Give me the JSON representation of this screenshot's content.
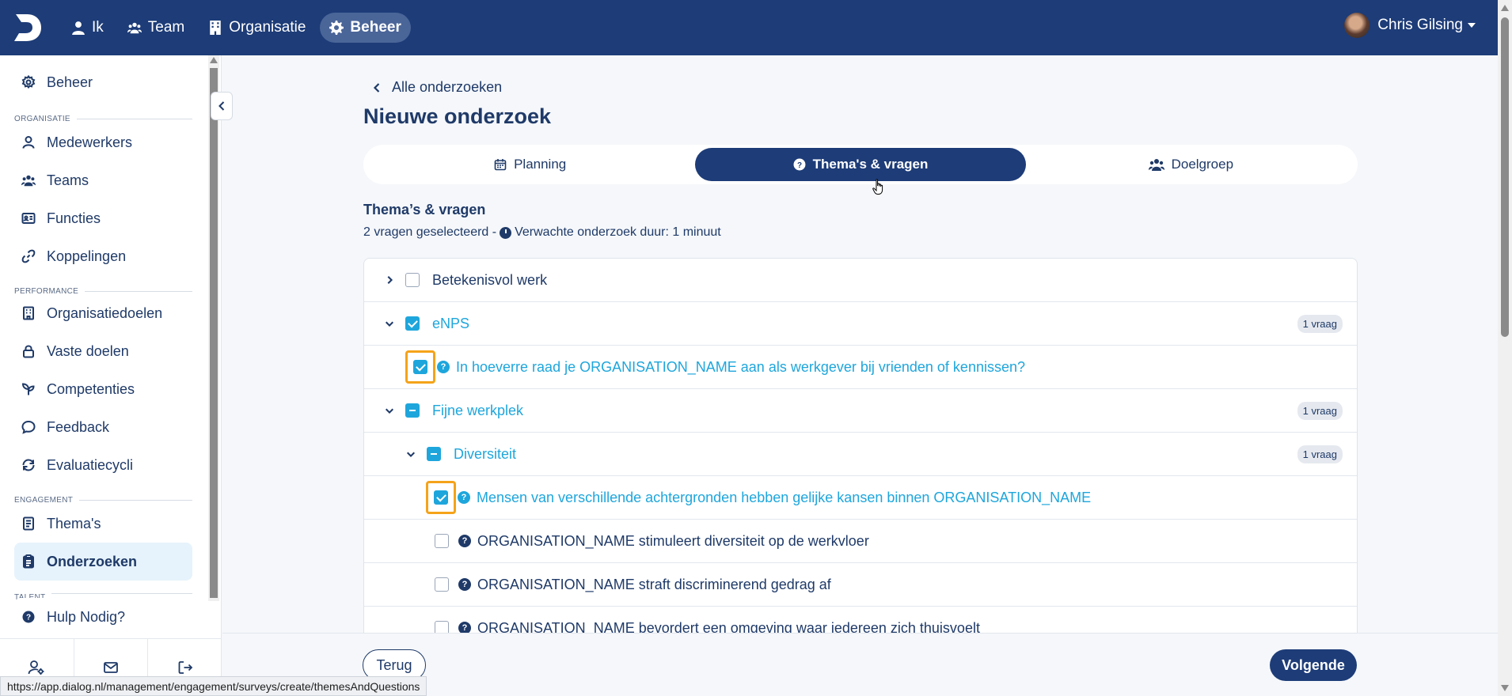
{
  "topbar": {
    "logo_letter": "D",
    "nav": [
      {
        "label": "Ik",
        "icon": "user-icon"
      },
      {
        "label": "Team",
        "icon": "users-icon"
      },
      {
        "label": "Organisatie",
        "icon": "building-icon"
      },
      {
        "label": "Beheer",
        "icon": "gear-icon",
        "active": true
      }
    ],
    "user_name": "Chris Gilsing"
  },
  "sidebar": {
    "top_item": "Beheer",
    "sections": {
      "organisatie": "ORGANISATIE",
      "performance": "PERFORMANCE",
      "engagement": "ENGAGEMENT",
      "talent": "TALENT"
    },
    "items": {
      "medewerkers": "Medewerkers",
      "teams": "Teams",
      "functies": "Functies",
      "koppelingen": "Koppelingen",
      "organisatiedoelen": "Organisatiedoelen",
      "vaste_doelen": "Vaste doelen",
      "competenties": "Competenties",
      "feedback": "Feedback",
      "evaluatiecycli": "Evaluatiecycli",
      "themas": "Thema's",
      "onderzoeken": "Onderzoeken",
      "hulp": "Hulp Nodig?"
    }
  },
  "main": {
    "back_link": "Alle onderzoeken",
    "title": "Nieuwe onderzoek",
    "tabs": [
      {
        "label": "Planning",
        "icon": "calendar-icon"
      },
      {
        "label": "Thema's & vragen",
        "icon": "question-circle-icon",
        "active": true
      },
      {
        "label": "Doelgroep",
        "icon": "users-icon"
      }
    ],
    "section_title": "Thema’s & vragen",
    "section_sub_count": "2 vragen geselecteerd -",
    "section_sub_duration": "Verwachte onderzoek duur: 1 minuut",
    "rows": [
      {
        "label": "Betekenisvol werk"
      },
      {
        "label": "eNPS",
        "badge": "1 vraag"
      },
      {
        "label": "In hoeverre raad je ORGANISATION_NAME aan als werkgever bij vrienden of kennissen?"
      },
      {
        "label": "Fijne werkplek",
        "badge": "1 vraag"
      },
      {
        "label": "Diversiteit",
        "badge": "1 vraag"
      },
      {
        "label": "Mensen van verschillende achtergronden hebben gelijke kansen binnen ORGANISATION_NAME"
      },
      {
        "label": "ORGANISATION_NAME stimuleert diversiteit op de werkvloer"
      },
      {
        "label": "ORGANISATION_NAME straft discriminerend gedrag af"
      },
      {
        "label": "ORGANISATION_NAME bevordert een omgeving waar iedereen zich thuisvoelt"
      }
    ]
  },
  "footer": {
    "back_button": "Terug",
    "next_button": "Volgende"
  },
  "status_url": "https://app.dialog.nl/management/engagement/surveys/create/themesAndQuestions",
  "colors": {
    "navy": "#1d3c78",
    "accent_blue": "#1ea6dc",
    "highlight_orange": "#f5a31a"
  }
}
